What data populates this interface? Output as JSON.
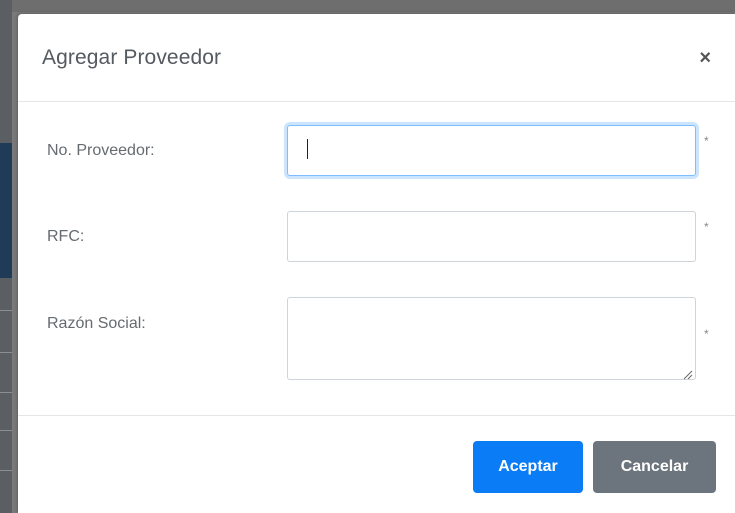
{
  "modal": {
    "title": "Agregar Proveedor",
    "close_symbol": "×"
  },
  "form": {
    "fields": [
      {
        "label": "No. Proveedor:",
        "value": "",
        "required_mark": "*"
      },
      {
        "label": "RFC:",
        "value": "",
        "required_mark": "*"
      },
      {
        "label": "Razón Social:",
        "value": "",
        "required_mark": "*"
      }
    ]
  },
  "footer": {
    "accept_label": "Aceptar",
    "cancel_label": "Cancelar"
  },
  "colors": {
    "primary": "#0a7cf5",
    "secondary": "#6c757d",
    "focus_ring": "#80bdff"
  },
  "icons": {
    "close": "close-icon",
    "resize": "resize-grip-icon"
  }
}
